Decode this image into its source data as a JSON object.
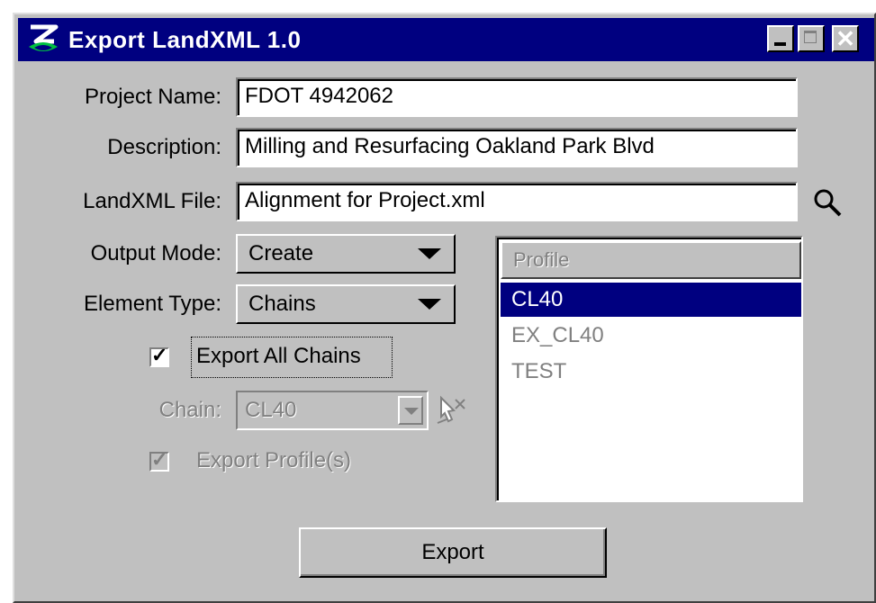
{
  "window": {
    "title": "Export LandXML 1.0",
    "title_bar_color": "#000080",
    "face_color": "#c0c0c0"
  },
  "form": {
    "project_name": {
      "label": "Project Name:",
      "value": "FDOT 4942062"
    },
    "description": {
      "label": "Description:",
      "value": "Milling and Resurfacing Oakland Park Blvd"
    },
    "landxml_file": {
      "label": "LandXML File:",
      "value": "Alignment for Project.xml",
      "browse_icon": "magnifier-icon"
    },
    "output_mode": {
      "label": "Output Mode:",
      "value": "Create"
    },
    "element_type": {
      "label": "Element Type:",
      "value": "Chains"
    },
    "export_all_chains": {
      "label": "Export All Chains",
      "checked": true
    },
    "chain": {
      "label": "Chain:",
      "value": "CL40",
      "enabled": false,
      "pick_icon": "cursor-pick-icon"
    },
    "export_profiles": {
      "label": "Export Profile(s)",
      "checked": true,
      "enabled": false
    }
  },
  "profile_list": {
    "header": "Profile",
    "items": [
      {
        "label": "CL40",
        "selected": true
      },
      {
        "label": "EX_CL40",
        "selected": false
      },
      {
        "label": "TEST",
        "selected": false
      }
    ]
  },
  "buttons": {
    "export": "Export"
  }
}
